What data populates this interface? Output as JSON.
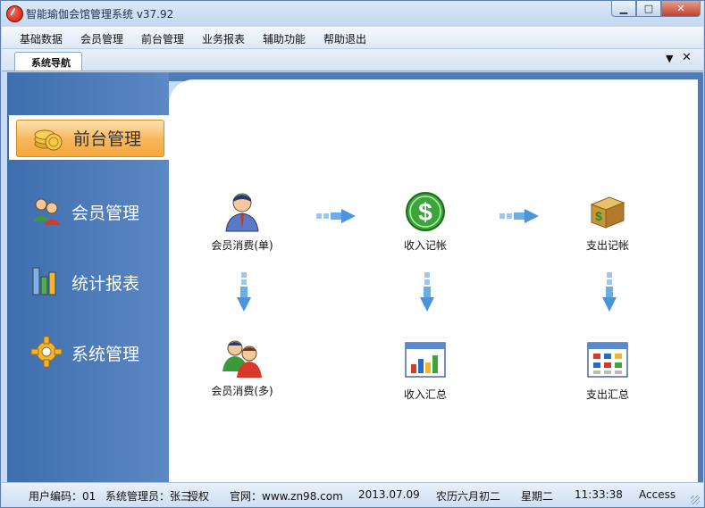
{
  "window": {
    "title": "智能瑜伽会馆管理系统 v37.92",
    "minimize": "▁",
    "maximize": "□",
    "close": "✕"
  },
  "menu": [
    "基础数据",
    "会员管理",
    "前台管理",
    "业务报表",
    "辅助功能",
    "帮助退出"
  ],
  "tab": {
    "label": "系统导航",
    "dropdown": "▼",
    "close": "✕"
  },
  "nav": [
    {
      "label": "前台管理",
      "icon": "coins-icon",
      "active": true
    },
    {
      "label": "会员管理",
      "icon": "users-icon",
      "active": false
    },
    {
      "label": "统计报表",
      "icon": "bar-chart-icon",
      "active": false
    },
    {
      "label": "系统管理",
      "icon": "gear-icon",
      "active": false
    }
  ],
  "flow": {
    "member_single": "会员消费(单)",
    "income_record": "收入记帐",
    "expense_record": "支出记帐",
    "member_multi": "会员消费(多)",
    "income_summary": "收入汇总",
    "expense_summary": "支出汇总"
  },
  "status": {
    "user_code": "用户编码：01",
    "admin": "系统管理员：张三",
    "auth": "授权",
    "site": "官网：www.zn98.com",
    "date": "2013.07.09",
    "lunar": "农历六月初二",
    "weekday": "星期二",
    "time": "11:33:38",
    "db": "Access"
  },
  "colors": {
    "nav_bg": "#4a7ab8",
    "active_btn": "#f8b85e",
    "titlebar": "#c4d8f0"
  }
}
